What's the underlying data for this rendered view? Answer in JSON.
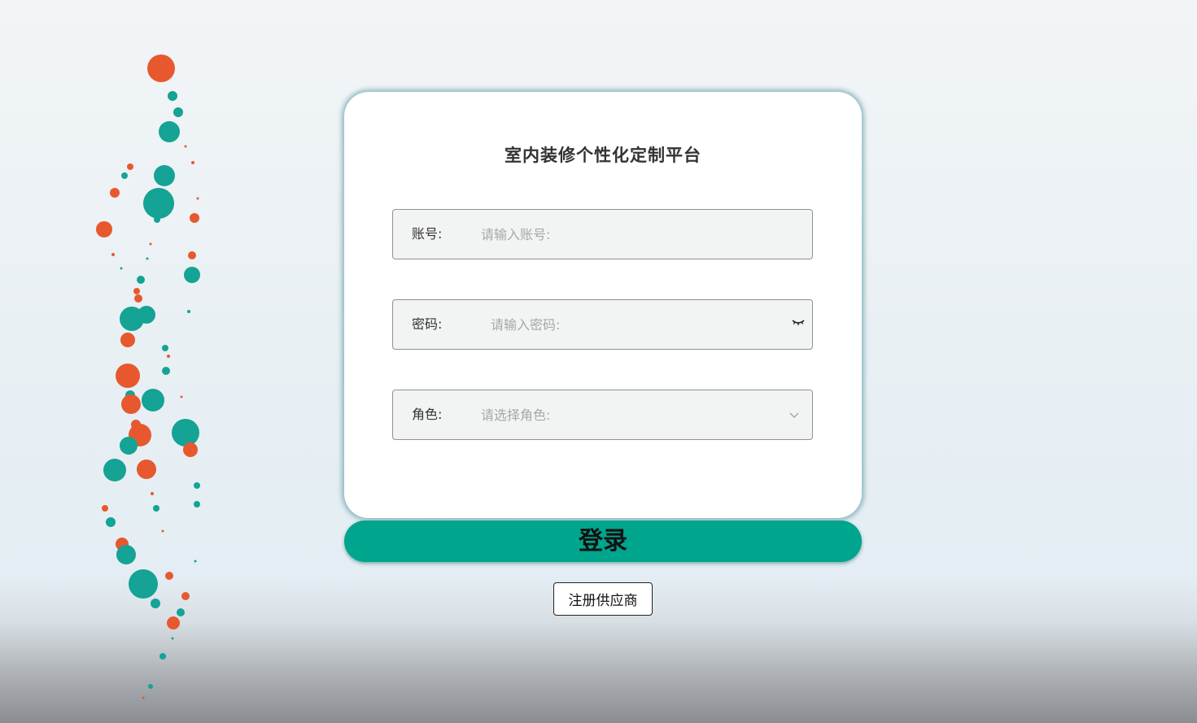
{
  "login_form": {
    "title": "室内装修个性化定制平台",
    "account": {
      "label": "账号:",
      "placeholder": "请输入账号:",
      "value": ""
    },
    "password": {
      "label": "密码:",
      "placeholder": "请输入密码:",
      "value": "",
      "toggle_icon": "eye-closed-icon"
    },
    "role": {
      "label": "角色:",
      "placeholder": "请选择角色:",
      "selected": "",
      "dropdown_icon": "chevron-down-icon"
    }
  },
  "actions": {
    "login_label": "登录",
    "register_label": "注册供应商"
  },
  "colors": {
    "accent": "#00a58d",
    "bubble_teal": "#14a394",
    "bubble_orange": "#e8582f",
    "card_bg": "#ffffff",
    "field_bg": "#f2f3f3"
  }
}
